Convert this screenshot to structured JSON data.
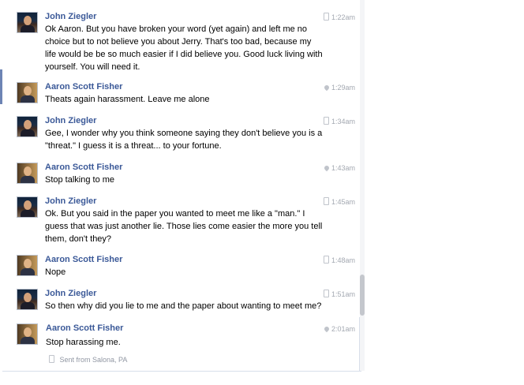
{
  "conversation": {
    "messages": [
      {
        "sender": "John Ziegler",
        "time": "1:22am",
        "device": "phone-icon",
        "lines": [
          "Ok Aaron. But you have broken your word (yet again) and left me no",
          "choice but to not believe you about Jerry. That's too bad, because my",
          "life would be be so much easier if I did believe you. Good luck living with",
          "yourself. You will need it."
        ]
      },
      {
        "sender": "Aaron Scott Fisher",
        "time": "1:29am",
        "device": "location-pin-icon",
        "lines": [
          "Theats again harassment. Leave me alone"
        ]
      },
      {
        "sender": "John Ziegler",
        "time": "1:34am",
        "device": "phone-icon",
        "lines": [
          "Gee, I wonder why you think someone saying they don't believe you is a",
          "\"threat.\" I guess it is a threat... to your fortune."
        ]
      },
      {
        "sender": "Aaron Scott Fisher",
        "time": "1:43am",
        "device": "location-pin-icon",
        "lines": [
          "Stop talking to me"
        ]
      },
      {
        "sender": "John Ziegler",
        "time": "1:45am",
        "device": "phone-icon",
        "lines": [
          "Ok. But you said in the paper you wanted to meet me like a \"man.\" I",
          "guess that was just another lie. Those lies come easier the more you tell",
          "them, don't they?"
        ]
      },
      {
        "sender": "Aaron Scott Fisher",
        "time": "1:48am",
        "device": "phone-icon",
        "lines": [
          "Nope"
        ]
      },
      {
        "sender": "John Ziegler",
        "time": "1:51am",
        "device": "phone-icon",
        "lines": [
          "So then why did you lie to me and the paper about wanting to meet me?"
        ]
      },
      {
        "sender": "Aaron Scott Fisher",
        "time": "2:01am",
        "device": "location-pin-icon",
        "lines": [
          "Stop harassing me."
        ]
      }
    ],
    "sent_from": "Sent from Salona, PA"
  },
  "colors": {
    "name": "#3b5998",
    "meta": "#a3a8b1"
  }
}
